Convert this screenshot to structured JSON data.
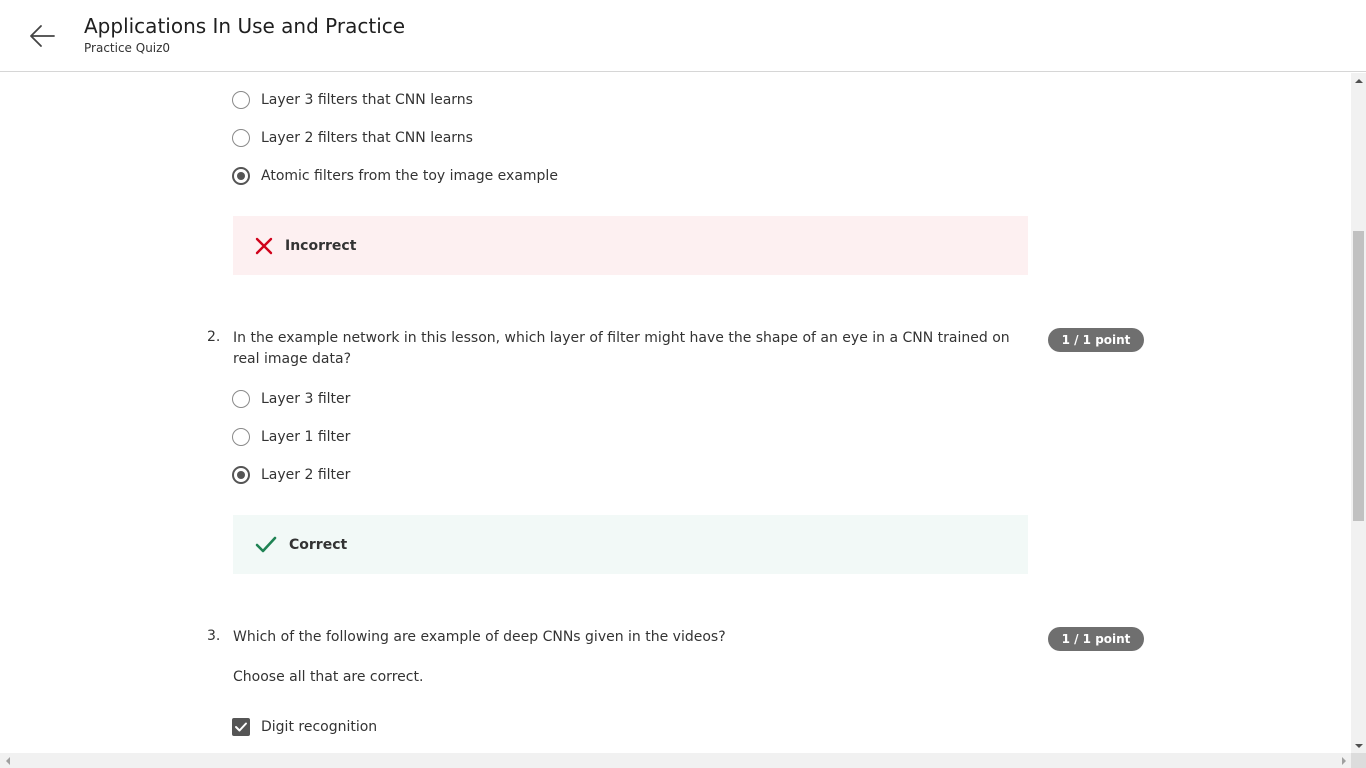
{
  "header": {
    "title": "Applications In Use and Practice",
    "subtitle": "Practice Quiz0"
  },
  "question1": {
    "options": [
      {
        "label": "Layer 3 filters that CNN learns",
        "selected": false
      },
      {
        "label": "Layer 2 filters that CNN learns",
        "selected": false
      },
      {
        "label": "Atomic filters from the toy image example",
        "selected": true
      }
    ],
    "feedback": "Incorrect"
  },
  "question2": {
    "number": "2.",
    "text": "In the example network in this lesson, which layer of filter might have the shape of an eye in a CNN trained on real image data?",
    "score": "1 / 1 point",
    "options": [
      {
        "label": "Layer 3 filter",
        "selected": false
      },
      {
        "label": "Layer 1 filter",
        "selected": false
      },
      {
        "label": "Layer 2 filter",
        "selected": true
      }
    ],
    "feedback": "Correct"
  },
  "question3": {
    "number": "3.",
    "text": "Which of the following are example of deep CNNs given in the videos?",
    "score": "1 / 1 point",
    "instruction": "Choose all that are correct.",
    "options": [
      {
        "label": "Digit recognition",
        "checked": true
      }
    ]
  },
  "colors": {
    "incorrect_icon": "#d0021b",
    "correct_icon": "#1f8354",
    "incorrect_bg": "#fdf0f1",
    "correct_bg": "#f2f9f7",
    "badge_bg": "#6f6f6f"
  }
}
